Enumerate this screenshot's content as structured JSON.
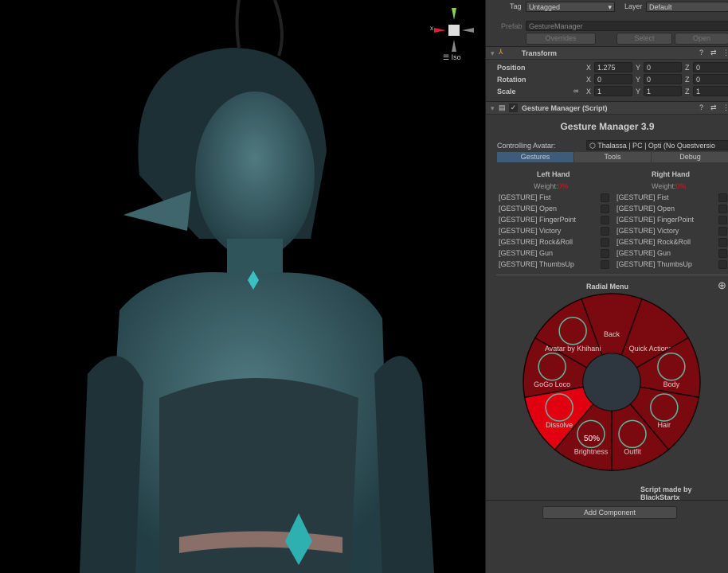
{
  "scene": {
    "gizmo_axis_x": "x",
    "projection": "Iso"
  },
  "inspector": {
    "tag_label": "Tag",
    "tag_value": "Untagged",
    "layer_label": "Layer",
    "layer_value": "Default",
    "prefab_label": "Prefab",
    "prefab_value": "GestureManager",
    "overrides": "Overrides",
    "select": "Select",
    "open": "Open",
    "transform": {
      "title": "Transform",
      "rows": [
        {
          "label": "Position",
          "x": "1.275",
          "y": "0",
          "z": "0"
        },
        {
          "label": "Rotation",
          "x": "0",
          "y": "0",
          "z": "0"
        },
        {
          "label": "Scale",
          "x": "1",
          "y": "1",
          "z": "1"
        }
      ],
      "axes": {
        "x": "X",
        "y": "Y",
        "z": "Z"
      }
    },
    "script": {
      "title": "Gesture Manager (Script)",
      "heading": "Gesture Manager 3.9",
      "controlling_label": "Controlling Avatar:",
      "avatar_value": "Thalassa | PC | Opti (No Questversio",
      "tabs": [
        "Gestures",
        "Tools",
        "Debug"
      ],
      "left_hand": "Left Hand",
      "right_hand": "Right Hand",
      "weight_label": "Weight:",
      "left_weight": "0%",
      "right_weight": "0%",
      "gestures": [
        "[GESTURE] Fist",
        "[GESTURE] Open",
        "[GESTURE] FingerPoint",
        "[GESTURE] Victory",
        "[GESTURE] Rock&Roll",
        "[GESTURE] Gun",
        "[GESTURE] ThumbsUp"
      ],
      "radial_title": "Radial Menu",
      "radial_items": [
        "Back",
        "Quick Actions",
        "Body",
        "Hair",
        "Outfit",
        "Brightness",
        "Dissolve",
        "GoGo Loco",
        "Avatar by Khihani"
      ],
      "brightness_value": "50%",
      "credit": "Script made by BlackStartx"
    },
    "add_component": "Add Component"
  },
  "colors": {
    "segment": "#7a0a10",
    "segment_active": "#e00010",
    "ring": "#5fb8a0",
    "hub": "#2e3640"
  }
}
